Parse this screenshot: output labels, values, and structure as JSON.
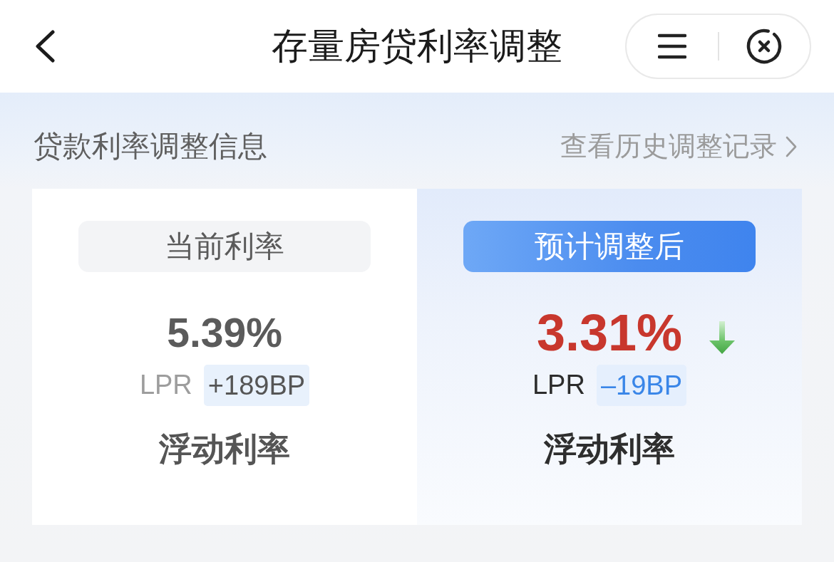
{
  "header": {
    "title": "存量房贷利率调整"
  },
  "section": {
    "title": "贷款利率调整信息",
    "link": "查看历史调整记录"
  },
  "panels": [
    {
      "kind": "current",
      "label": "当前利率",
      "rate": "5.39%",
      "falling": false,
      "base": "LPR",
      "spread": "+189BP",
      "rate_type": "浮动利率"
    },
    {
      "kind": "projected",
      "label": "预计调整后",
      "rate": "3.31%",
      "falling": true,
      "base": "LPR",
      "spread": "–19BP",
      "rate_type": "浮动利率"
    }
  ]
}
